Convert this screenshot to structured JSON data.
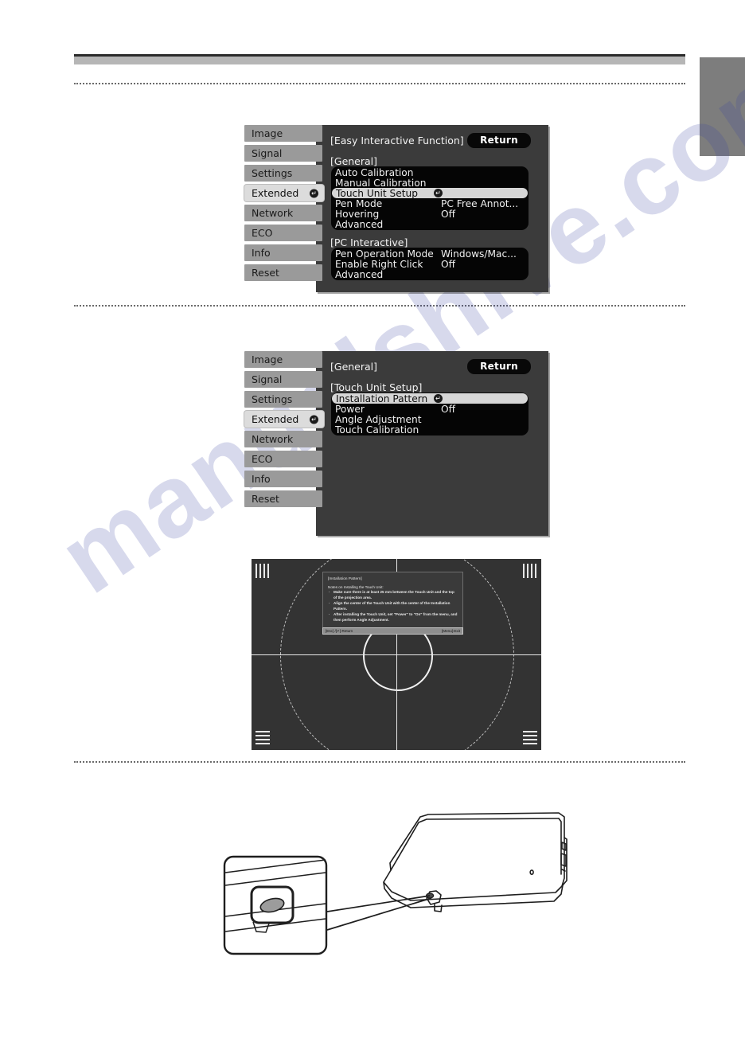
{
  "page": {
    "watermark": "manualshive.com"
  },
  "menu1": {
    "title": "[Easy Interactive Function]",
    "return_label": "Return",
    "sidebar": [
      {
        "label": "Image",
        "active": false
      },
      {
        "label": "Signal",
        "active": false
      },
      {
        "label": "Settings",
        "active": false
      },
      {
        "label": "Extended",
        "active": true
      },
      {
        "label": "Network",
        "active": false
      },
      {
        "label": "ECO",
        "active": false
      },
      {
        "label": "Info",
        "active": false
      },
      {
        "label": "Reset",
        "active": false
      }
    ],
    "group1_label": "[General]",
    "group1_items": [
      {
        "label": "Auto Calibration",
        "value": "",
        "selected": false,
        "enter": false
      },
      {
        "label": "Manual Calibration",
        "value": "",
        "selected": false,
        "enter": false
      },
      {
        "label": "Touch Unit Setup",
        "value": "",
        "selected": true,
        "enter": true
      },
      {
        "label": "Pen Mode",
        "value": "PC Free Annot...",
        "selected": false,
        "enter": false
      },
      {
        "label": "Hovering",
        "value": "Off",
        "selected": false,
        "enter": false
      },
      {
        "label": "Advanced",
        "value": "",
        "selected": false,
        "enter": false
      }
    ],
    "group2_label": "[PC Interactive]",
    "group2_items": [
      {
        "label": "Pen Operation Mode",
        "value": "Windows/Mac...",
        "selected": false,
        "enter": false
      },
      {
        "label": "Enable Right Click",
        "value": "Off",
        "selected": false,
        "enter": false
      },
      {
        "label": "Advanced",
        "value": "",
        "selected": false,
        "enter": false
      }
    ]
  },
  "menu2": {
    "title": "[General]",
    "return_label": "Return",
    "sidebar": [
      {
        "label": "Image",
        "active": false
      },
      {
        "label": "Signal",
        "active": false
      },
      {
        "label": "Settings",
        "active": false
      },
      {
        "label": "Extended",
        "active": true
      },
      {
        "label": "Network",
        "active": false
      },
      {
        "label": "ECO",
        "active": false
      },
      {
        "label": "Info",
        "active": false
      },
      {
        "label": "Reset",
        "active": false
      }
    ],
    "group1_label": "[Touch Unit Setup]",
    "group1_items": [
      {
        "label": "Installation Pattern",
        "value": "",
        "selected": true,
        "enter": true
      },
      {
        "label": "Power",
        "value": "Off",
        "selected": false,
        "enter": false
      },
      {
        "label": "Angle Adjustment",
        "value": "",
        "selected": false,
        "enter": false
      },
      {
        "label": "Touch Calibration",
        "value": "",
        "selected": false,
        "enter": false
      }
    ]
  },
  "pattern": {
    "title": "[Installation Pattern]",
    "lead": "Notes on Installing the Touch Unit:",
    "notes": [
      "Make sure there is at least 25 mm between the Touch Unit and the top of the projection area.",
      "Align the center of the Touch Unit with the center of the Installation Pattern.",
      "After installing the Touch Unit, set \"Power\" to \"On\" from the menu, and then perform Angle Adjustment."
    ],
    "hint_left": "[Esc] /[↵]:Return",
    "hint_right": "[Menu]:Exit"
  },
  "colors": {
    "osd_panel_bg": "#3b3b3b",
    "osd_list_bg": "#050505",
    "osd_tab_bg": "#9a9a9a",
    "osd_tab_active_bg": "#dcdcdc",
    "selection_bg": "#d6d6d6",
    "pattern_bg": "#333333",
    "side_tab": "#7d7d7d",
    "watermark": "#3642a0"
  }
}
